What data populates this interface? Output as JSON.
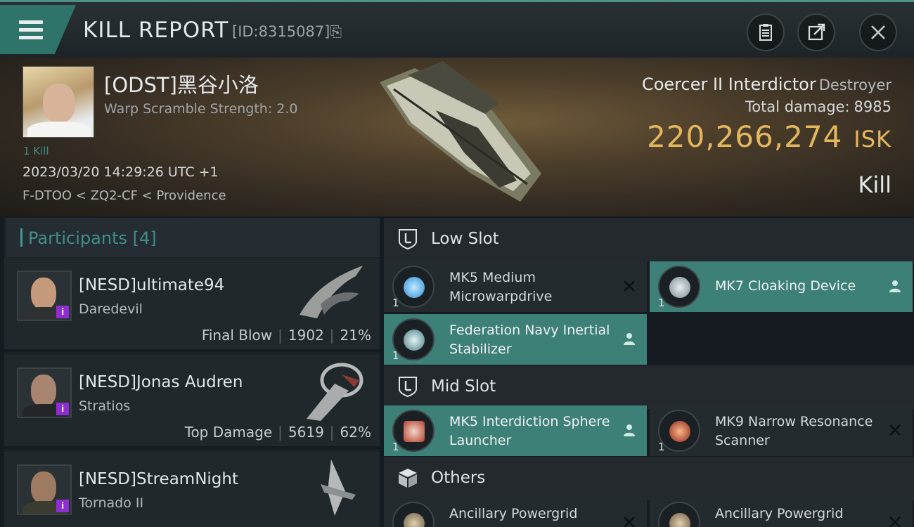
{
  "header": {
    "title": "KILL REPORT",
    "report_id": "[ID:8315087]",
    "copy_glyph": "⎘",
    "buttons": [
      {
        "name": "clipboard-icon"
      },
      {
        "name": "share-icon"
      },
      {
        "name": "close-icon"
      }
    ],
    "accent": "#2f746b"
  },
  "victim": {
    "name": "[ODST]黑谷小洛",
    "warp_scramble": "Warp Scramble Strength: 2.0",
    "kill_count": "1 Kill",
    "datetime": "2023/03/20 14:29:26 UTC +1",
    "location": "F-DTOO < ZQ2-CF < Providence",
    "ship_name": "Coercer II Interdictor",
    "ship_class": "Destroyer",
    "total_damage_label": "Total damage:",
    "total_damage": "8985",
    "isk_value": "220,266,274",
    "isk_unit": "ISK",
    "result": "Kill",
    "isk_color": "#e3b75d"
  },
  "participants": {
    "heading": "Participants",
    "count": "[4]",
    "rows": [
      {
        "name": "[NESD]ultimate94",
        "ship": "Daredevil",
        "stat_label": "Final Blow",
        "damage": "1902",
        "percent": "21%"
      },
      {
        "name": "[NESD]Jonas Audren",
        "ship": "Stratios",
        "stat_label": "Top Damage",
        "damage": "5619",
        "percent": "62%"
      },
      {
        "name": "[NESD]StreamNight",
        "ship": "Tornado II",
        "stat_label": "",
        "damage": "",
        "percent": ""
      }
    ]
  },
  "fitting": {
    "low_slot": {
      "label": "Low Slot",
      "modules": [
        {
          "name": "MK5 Medium Microwarpdrive",
          "qty": "1",
          "status": "destroyed"
        },
        {
          "name": "MK7 Cloaking Device",
          "qty": "1",
          "status": "dropped"
        },
        {
          "name": "Federation Navy Inertial Stabilizer",
          "qty": "1",
          "status": "dropped"
        }
      ]
    },
    "mid_slot": {
      "label": "Mid Slot",
      "modules": [
        {
          "name": "MK5 Interdiction Sphere Launcher",
          "qty": "1",
          "status": "dropped"
        },
        {
          "name": "MK9 Narrow Resonance Scanner",
          "qty": "1",
          "status": "destroyed"
        }
      ]
    },
    "others": {
      "label": "Others",
      "modules": [
        {
          "name": "Ancillary Powergrid",
          "qty": "",
          "status": "destroyed"
        },
        {
          "name": "Ancillary Powergrid",
          "qty": "",
          "status": "destroyed"
        }
      ]
    },
    "dropped_color": "#3d8077"
  }
}
